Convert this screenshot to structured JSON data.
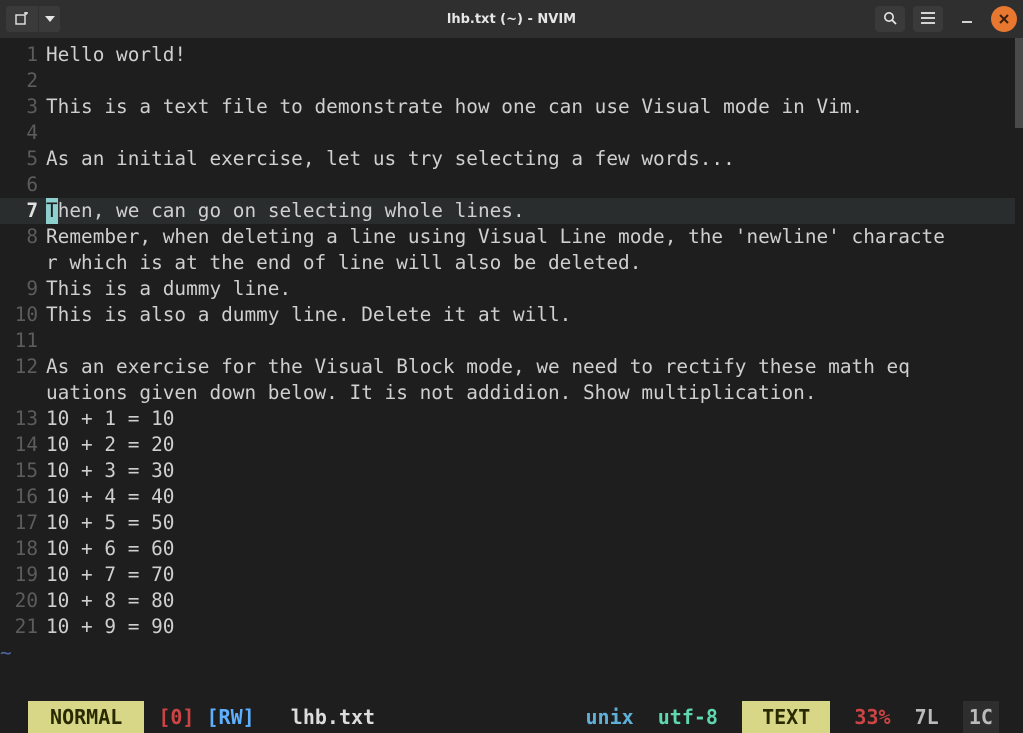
{
  "window": {
    "title": "lhb.txt (~) - NVIM"
  },
  "editor": {
    "cursor_line": 7,
    "lines": [
      {
        "n": 1,
        "text": "Hello world!"
      },
      {
        "n": 2,
        "text": ""
      },
      {
        "n": 3,
        "text": "This is a text file to demonstrate how one can use Visual mode in Vim."
      },
      {
        "n": 4,
        "text": ""
      },
      {
        "n": 5,
        "text": "As an initial exercise, let us try selecting a few words..."
      },
      {
        "n": 6,
        "text": ""
      },
      {
        "n": 7,
        "text": "Then, we can go on selecting whole lines."
      },
      {
        "n": 8,
        "text": "Remember, when deleting a line using Visual Line mode, the 'newline' character which is at the end of line will also be deleted.",
        "wrap_at": 77
      },
      {
        "n": 9,
        "text": "This is a dummy line."
      },
      {
        "n": 10,
        "text": "This is also a dummy line. Delete it at will."
      },
      {
        "n": 11,
        "text": ""
      },
      {
        "n": 12,
        "text": "As an exercise for the Visual Block mode, we need to rectify these math equations given down below. It is not addidion. Show multiplication.",
        "wrap_at": 74
      },
      {
        "n": 13,
        "text": "10 + 1 = 10"
      },
      {
        "n": 14,
        "text": "10 + 2 = 20"
      },
      {
        "n": 15,
        "text": "10 + 3 = 30"
      },
      {
        "n": 16,
        "text": "10 + 4 = 40"
      },
      {
        "n": 17,
        "text": "10 + 5 = 50"
      },
      {
        "n": 18,
        "text": "10 + 6 = 60"
      },
      {
        "n": 19,
        "text": "10 + 7 = 70"
      },
      {
        "n": 20,
        "text": "10 + 8 = 80"
      },
      {
        "n": 21,
        "text": "10 + 9 = 90"
      }
    ]
  },
  "status": {
    "mode": " NORMAL ",
    "git": "[0]",
    "rw": "[RW]",
    "filename": "lhb.txt",
    "format": "unix",
    "encoding": "utf-8",
    "filetype": " TEXT ",
    "percent": "33%",
    "line_pos": "7L",
    "col_pos": "1C"
  }
}
